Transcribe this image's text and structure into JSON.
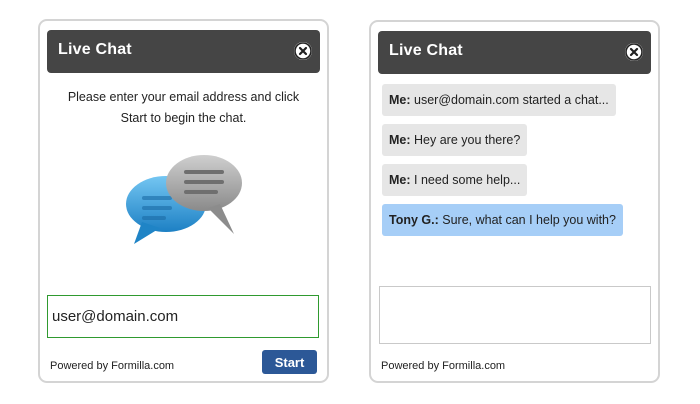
{
  "left_panel": {
    "title": "Live Chat",
    "intro_line1": "Please enter your email address and click",
    "intro_line2": "Start to begin the chat.",
    "email_value": "user@domain.com",
    "powered_by": "Powered by Formilla.com",
    "start_label": "Start"
  },
  "right_panel": {
    "title": "Live Chat",
    "messages": [
      {
        "sender": "Me:",
        "text": "user@domain.com started a chat...",
        "role": "user"
      },
      {
        "sender": "Me:",
        "text": "Hey are you there?",
        "role": "user"
      },
      {
        "sender": "Me:",
        "text": "I need some help...",
        "role": "user"
      },
      {
        "sender": "Tony G.:",
        "text": "Sure, what can I help you with?",
        "role": "agent"
      }
    ],
    "reply_value": "",
    "powered_by": "Powered by Formilla.com"
  },
  "colors": {
    "header_bg": "#454545",
    "start_button_bg": "#2c5897",
    "agent_bubble_bg": "#a6cef7",
    "user_bubble_bg": "#e6e6e6",
    "input_border_focus": "#2f9a2f"
  },
  "icons": {
    "close": "close-circle-icon",
    "chat": "chat-bubbles-icon"
  }
}
